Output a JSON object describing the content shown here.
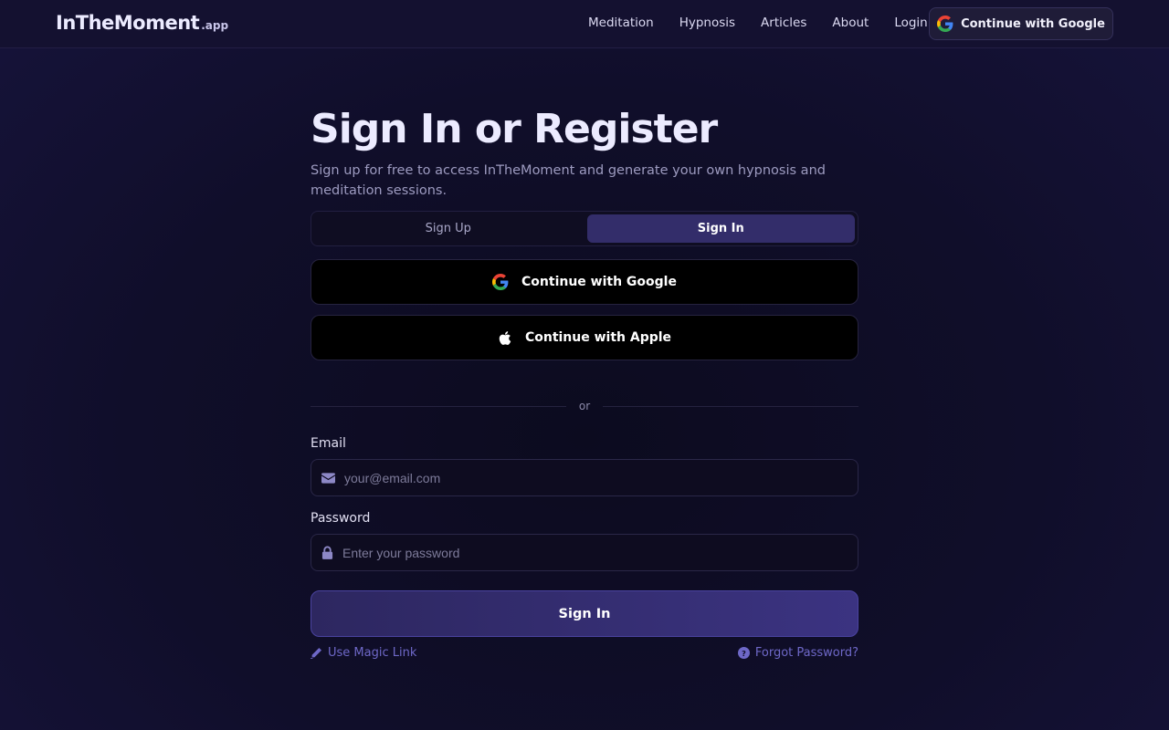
{
  "header": {
    "logo_main": "InTheMoment",
    "logo_tld": ".app",
    "nav": [
      "Meditation",
      "Hypnosis",
      "Articles",
      "About",
      "Login"
    ],
    "google_button": "Continue with Google"
  },
  "main": {
    "title": "Sign In or Register",
    "subtitle": "Sign up for free to access InTheMoment and generate your own hypnosis and meditation sessions.",
    "tabs": {
      "signup": "Sign Up",
      "signin": "Sign In",
      "active": "signin"
    },
    "google_button": "Continue with Google",
    "apple_button": "Continue with Apple",
    "divider_text": "or",
    "email_label": "Email",
    "email_placeholder": "your@email.com",
    "password_label": "Password",
    "password_placeholder": "Enter your password",
    "submit_label": "Sign In",
    "magic_link": "Use Magic Link",
    "forgot_password": "Forgot Password?"
  },
  "colors": {
    "background": "#0f0d26",
    "accent": "#332d6a",
    "link": "#6e68c8"
  }
}
